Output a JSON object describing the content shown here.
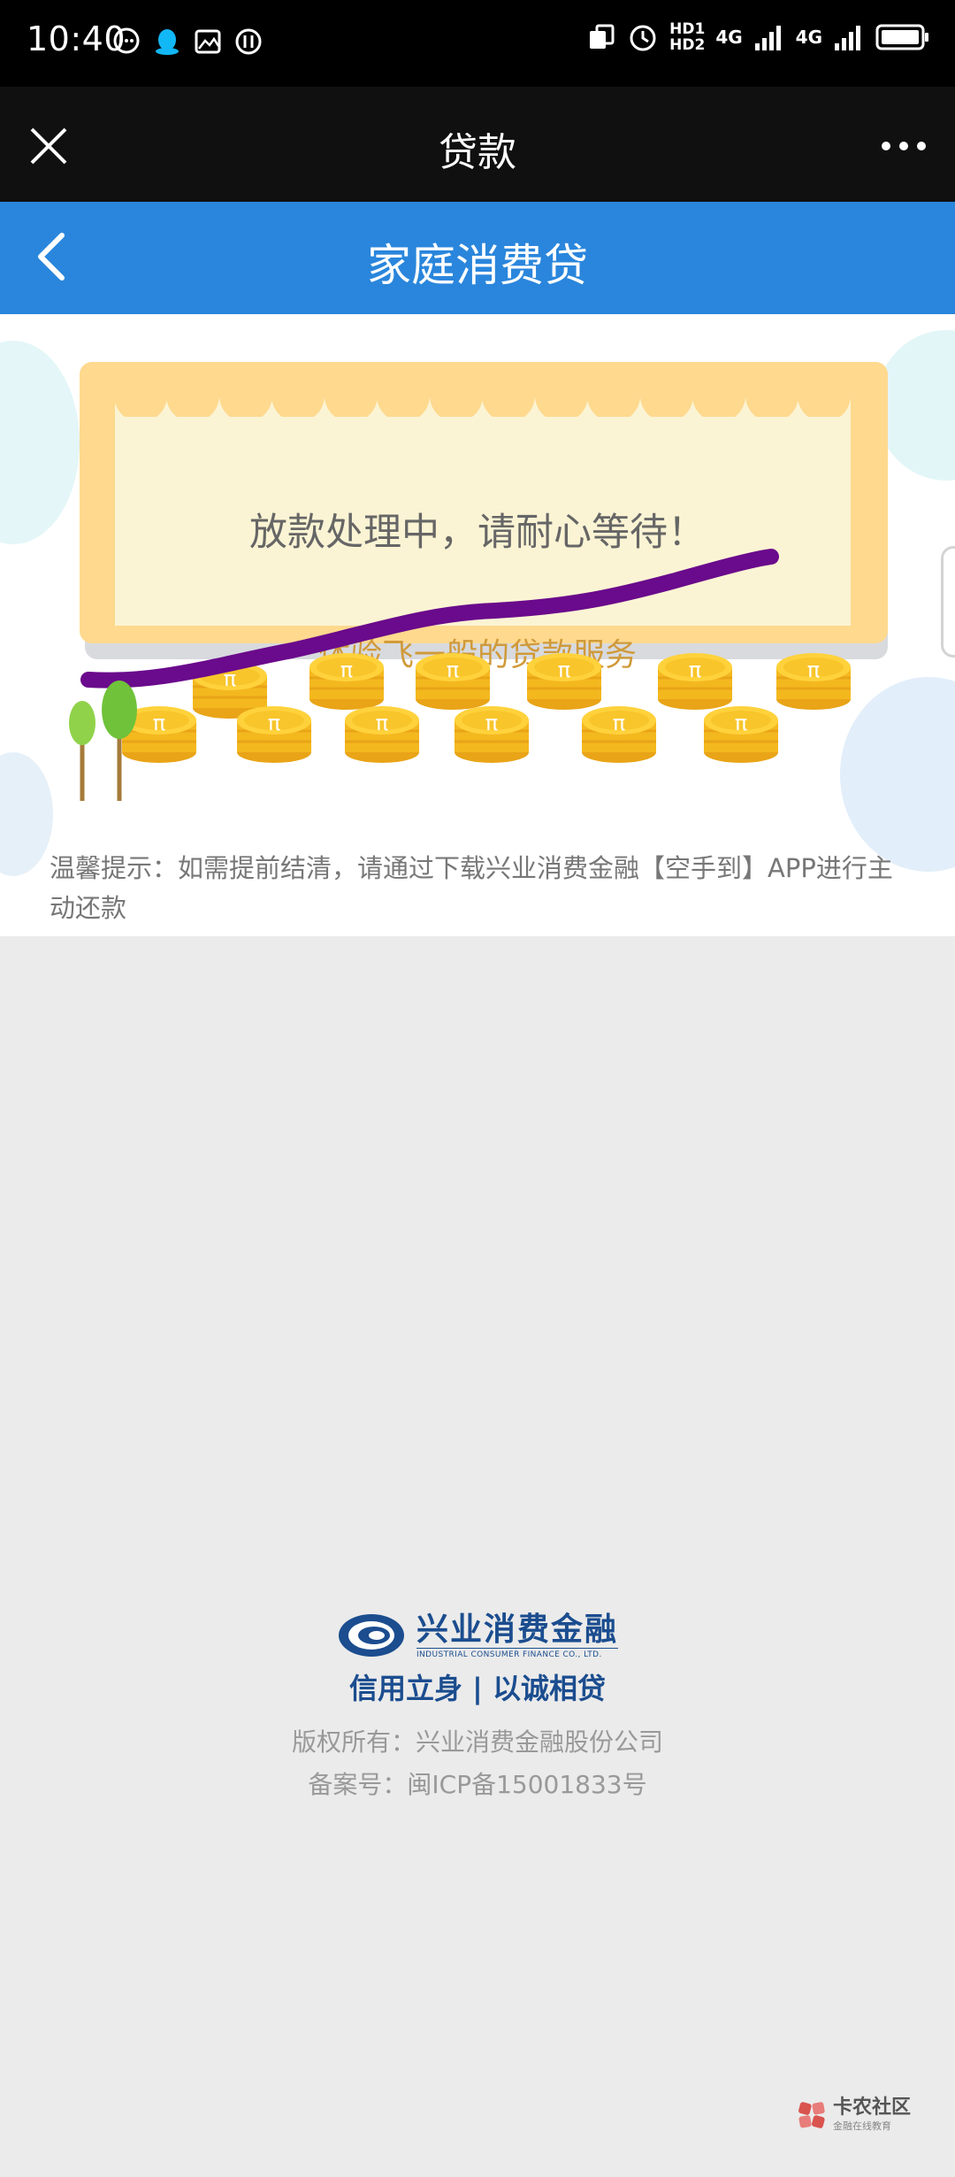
{
  "status_bar": {
    "time": "10:40",
    "hd1": "HD1",
    "hd2": "HD2",
    "net1": "4G",
    "net2": "4G"
  },
  "title_bar": {
    "title": "贷款",
    "close_icon": "close-icon",
    "more_icon": "more-icon"
  },
  "page_header": {
    "title": "家庭消费贷",
    "back_icon": "back-icon",
    "color": "#2a86dc"
  },
  "status_card": {
    "title": "放款处理中，请耐心等待！",
    "subtitle": "体验飞一般的贷款服务",
    "coin_symbol": "π"
  },
  "notice": {
    "text": "温馨提示：如需提前结清，请通过下载兴业消费金融【空手到】APP进行主动还款"
  },
  "footer": {
    "logo_cn": "兴业消费金融",
    "logo_en": "INDUSTRIAL CONSUMER FINANCE CO., LTD.",
    "slogan": "信用立身 | 以诚相贷",
    "copyright": "版权所有：兴业消费金融股份公司",
    "icp": "备案号：闽ICP备15001833号"
  },
  "watermark": {
    "name": "卡农社区",
    "subtitle": "金融在线教育"
  }
}
